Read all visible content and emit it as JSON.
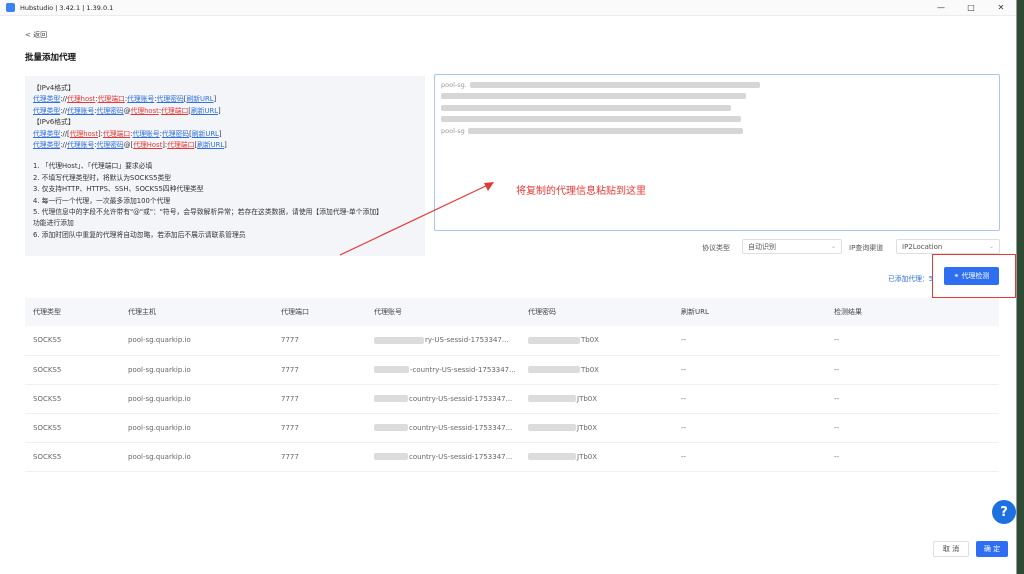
{
  "window": {
    "title": "Hubstudio | 3.42.1 | 1.39.0.1",
    "controls": [
      "—",
      "□",
      "✕"
    ]
  },
  "nav": {
    "back": "< 返回"
  },
  "page": {
    "title": "批量添加代理"
  },
  "format": {
    "ipv4_header": "【IPv4格式】",
    "ipv6_header": "【IPv6格式】",
    "t_type": "代理类型",
    "t_host": "代理host",
    "t_host6": "代理Host",
    "t_port": "代理端口",
    "t_account": "代理账号",
    "t_password": "代理密码",
    "t_refresh": "刷新URL",
    "notes": [
      "1. 「代理Host」、「代理端口」要求必填",
      "2. 不填写代理类型时，将默认为SOCKS5类型",
      "3. 仅支持HTTP、HTTPS、SSH、SOCKS5四种代理类型",
      "4. 每一行一个代理，一次最多添加100个代理",
      "5. 代理信息中的字段不允许带有\"@\"或\"：\"符号，会导致解析异常；若存在这类数据，请使用【添加代理-单个添加】",
      "功能进行添加",
      "6. 添加时团队中重复的代理将自动忽略，若添加后不展示请联系管理员"
    ]
  },
  "input": {
    "first_prefix": "pool-sg.",
    "last_prefix": "pool-sg"
  },
  "annotation": {
    "text": "将复制的代理信息粘贴到这里"
  },
  "filters": {
    "protocol_label": "协议类型",
    "protocol_value": "自动识别",
    "ip_channel_label": "IP查询渠道",
    "ip_channel_value": "IP2Location"
  },
  "summary": {
    "added_label": "已添加代理：5"
  },
  "actions": {
    "detect": "代理检测",
    "cancel": "取 消",
    "confirm": "确 定"
  },
  "table": {
    "headers": [
      "代理类型",
      "代理主机",
      "代理端口",
      "代理账号",
      "代理密码",
      "刷新URL",
      "检测结果"
    ],
    "rows": [
      {
        "type": "SOCKS5",
        "host": "pool-sg.quarkip.io",
        "port": "7777",
        "account": "ry-US-sessid-1753347...",
        "password": "Tb0X",
        "refresh": "--",
        "result": "--"
      },
      {
        "type": "SOCKS5",
        "host": "pool-sg.quarkip.io",
        "port": "7777",
        "account": "-country-US-sessid-1753347...",
        "password": "Tb0X",
        "refresh": "--",
        "result": "--"
      },
      {
        "type": "SOCKS5",
        "host": "pool-sg.quarkip.io",
        "port": "7777",
        "account": "country-US-sessid-1753347...",
        "password": "JTb0X",
        "refresh": "--",
        "result": "--"
      },
      {
        "type": "SOCKS5",
        "host": "pool-sg.quarkip.io",
        "port": "7777",
        "account": "country-US-sessid-1753347...",
        "password": "JTb0X",
        "refresh": "--",
        "result": "--"
      },
      {
        "type": "SOCKS5",
        "host": "pool-sg.quarkip.io",
        "port": "7777",
        "account": "country-US-sessid-1753347...",
        "password": "JTb0X",
        "refresh": "--",
        "result": "--"
      }
    ]
  },
  "help": {
    "label": "?"
  }
}
